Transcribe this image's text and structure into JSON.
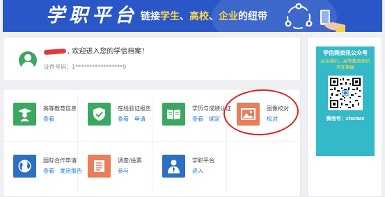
{
  "banner": {
    "title": "学职平台",
    "slogan_prefix": "链接",
    "slogan_student": "学生",
    "slogan_sep1": "、",
    "slogan_school": "高校",
    "slogan_sep2": "、",
    "slogan_company": "企业",
    "slogan_suffix": "的纽带"
  },
  "welcome": {
    "greeting": ", 欢迎进入您的学信档案！",
    "id_label": "证件号码：",
    "id_value": "1*****************9"
  },
  "services": [
    {
      "key": "higher-education-info",
      "title": "高等教育信息",
      "links": [
        "查看"
      ],
      "color": "#3aa860",
      "icon": "graduate-icon"
    },
    {
      "key": "online-verification-report",
      "title": "在线验证报告",
      "links": [
        "查看",
        "申请"
      ],
      "color": "#3aa860",
      "icon": "shield-check-icon"
    },
    {
      "key": "degree-certification",
      "title": "学历与成绩认证",
      "links": [
        "查看",
        "绑定"
      ],
      "color": "#3aa860",
      "icon": "open-book-icon"
    },
    {
      "key": "image-verification",
      "title": "图像校对",
      "links": [
        "校对"
      ],
      "color": "#ea7d5a",
      "icon": "image-icon"
    },
    {
      "key": "international-cooperation",
      "title": "国际合作申请",
      "links": [
        "查看",
        "发送报告"
      ],
      "color": "#2d6fc3",
      "icon": "globe-icon"
    },
    {
      "key": "survey-voting",
      "title": "调查/投票",
      "links": [
        "参与"
      ],
      "color": "#ea7d5a",
      "icon": "list-icon"
    },
    {
      "key": "career-platform",
      "title": "学职平台",
      "links": [
        "进入"
      ],
      "color": "#2d6fc3",
      "icon": "person-tie-icon"
    }
  ],
  "ad": {
    "line1": "学信网资讯公众号",
    "line2": "关注我们，高等教育资讯",
    "line3": "尽在掌握",
    "wechat": "微信号：chsiwx",
    "background": "#34b9c8"
  },
  "colors": {
    "banner": "#2a57c7",
    "link": "#1f7ad6",
    "highlight_circle": "#e02020"
  }
}
